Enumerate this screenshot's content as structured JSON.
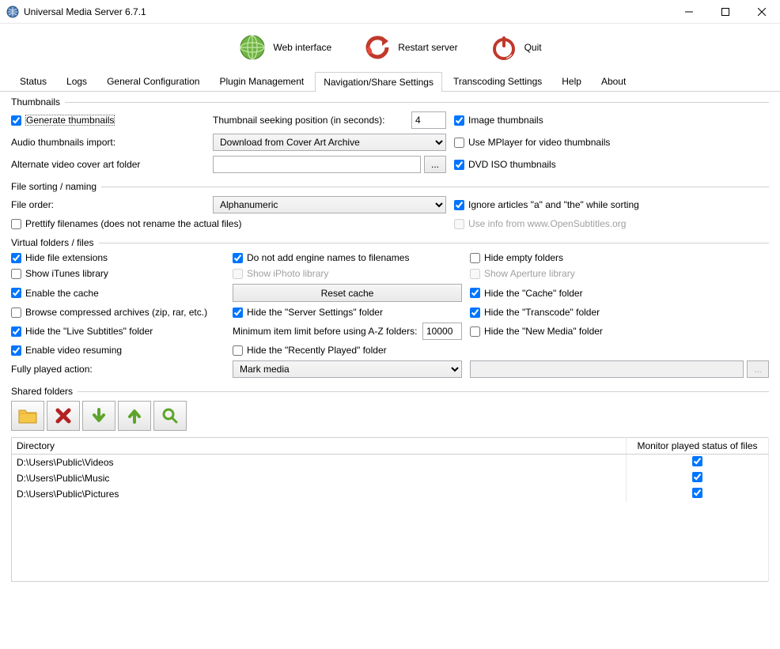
{
  "window": {
    "title": "Universal Media Server 6.7.1"
  },
  "toolbar": {
    "web": "Web interface",
    "restart": "Restart server",
    "quit": "Quit"
  },
  "tabs": {
    "status": "Status",
    "logs": "Logs",
    "general": "General Configuration",
    "plugin": "Plugin Management",
    "nav": "Navigation/Share Settings",
    "transcode": "Transcoding Settings",
    "help": "Help",
    "about": "About"
  },
  "groups": {
    "thumbnails": "Thumbnails",
    "sorting": "File sorting / naming",
    "virtual": "Virtual folders / files",
    "shared": "Shared folders"
  },
  "thumbnails": {
    "generate": "Generate thumbnails",
    "seek_label": "Thumbnail seeking position (in seconds):",
    "seek_value": "4",
    "image": "Image thumbnails",
    "audio_label": "Audio thumbnails import:",
    "audio_select": "Download from Cover Art Archive",
    "mplayer": "Use MPlayer for video thumbnails",
    "alt_cover_label": "Alternate video cover art folder",
    "alt_cover_value": "",
    "browse": "...",
    "dvd_iso": "DVD ISO thumbnails"
  },
  "sorting": {
    "order_label": "File order:",
    "order_value": "Alphanumeric",
    "ignore_articles": "Ignore articles \"a\" and \"the\" while sorting",
    "prettify": "Prettify filenames (does not rename the actual files)",
    "opensubs": "Use info from www.OpenSubtitles.org"
  },
  "virtual": {
    "hide_ext": "Hide file extensions",
    "no_engine": "Do not add engine names to filenames",
    "hide_empty": "Hide empty folders",
    "itunes": "Show iTunes library",
    "iphoto": "Show iPhoto library",
    "aperture": "Show Aperture library",
    "enable_cache": "Enable the cache",
    "reset_cache": "Reset cache",
    "hide_cache": "Hide the \"Cache\" folder",
    "browse_archives": "Browse compressed archives (zip, rar, etc.)",
    "hide_server": "Hide the \"Server Settings\" folder",
    "hide_transcode": "Hide the \"Transcode\" folder",
    "hide_live_subs": "Hide the \"Live Subtitles\" folder",
    "min_item_label": "Minimum item limit before using A-Z folders:",
    "min_item_value": "10000",
    "hide_new_media": "Hide the \"New Media\" folder",
    "enable_resume": "Enable video resuming",
    "hide_recently": "Hide the \"Recently Played\" folder",
    "fully_played_label": "Fully played action:",
    "fully_played_value": "Mark media",
    "ellipsis": "..."
  },
  "shared": {
    "col_dir": "Directory",
    "col_monitor": "Monitor played status of files",
    "rows": [
      {
        "dir": "D:\\Users\\Public\\Videos",
        "monitor": true
      },
      {
        "dir": "D:\\Users\\Public\\Music",
        "monitor": true
      },
      {
        "dir": "D:\\Users\\Public\\Pictures",
        "monitor": true
      }
    ]
  }
}
